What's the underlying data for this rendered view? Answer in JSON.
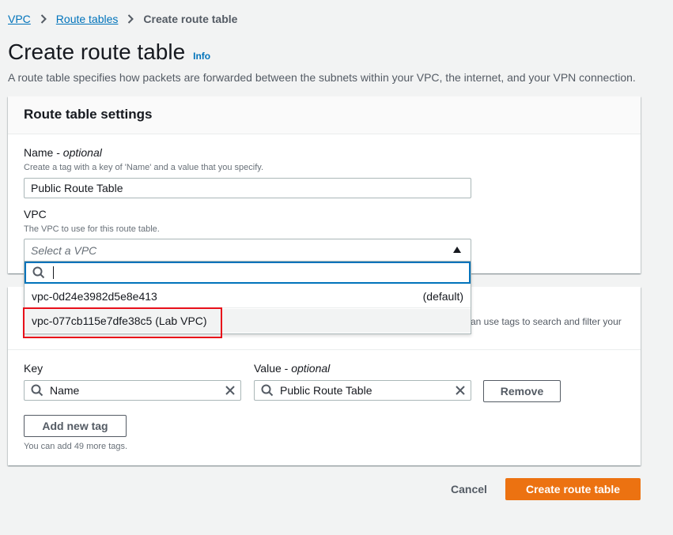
{
  "breadcrumb": {
    "items": [
      "VPC",
      "Route tables"
    ],
    "current": "Create route table"
  },
  "page": {
    "title": "Create route table",
    "info_link": "Info",
    "description": "A route table specifies how packets are forwarded between the subnets within your VPC, the internet, and your VPN connection."
  },
  "settings": {
    "title": "Route table settings",
    "name_label": "Name - ",
    "name_optional": "optional",
    "name_hint": "Create a tag with a key of 'Name' and a value that you specify.",
    "name_value": "Public Route Table",
    "vpc_label": "VPC",
    "vpc_hint": "The VPC to use for this route table.",
    "vpc_placeholder": "Select a VPC",
    "vpc_search_value": "",
    "vpc_options": [
      {
        "label": "vpc-0d24e3982d5e8e413",
        "tag": "(default)"
      },
      {
        "label": "vpc-077cb115e7dfe38c5 (Lab VPC)",
        "tag": ""
      }
    ],
    "highlighted_option": "vpc-077cb115e7dfe38c5 (Lab VPC)"
  },
  "tags": {
    "desc_tail": "an use tags to search and filter your",
    "key_label": "Key",
    "value_label": "Value - ",
    "value_optional": "optional",
    "rows": [
      {
        "key": "Name",
        "value": "Public Route Table"
      }
    ],
    "remove_label": "Remove",
    "add_label": "Add new tag",
    "remaining_hint": "You can add 49 more tags."
  },
  "footer": {
    "cancel_label": "Cancel",
    "create_label": "Create route table"
  },
  "colors": {
    "link": "#0073bb",
    "primary": "#ec7211",
    "highlight": "#e8101a",
    "focus": "#0073bb"
  }
}
